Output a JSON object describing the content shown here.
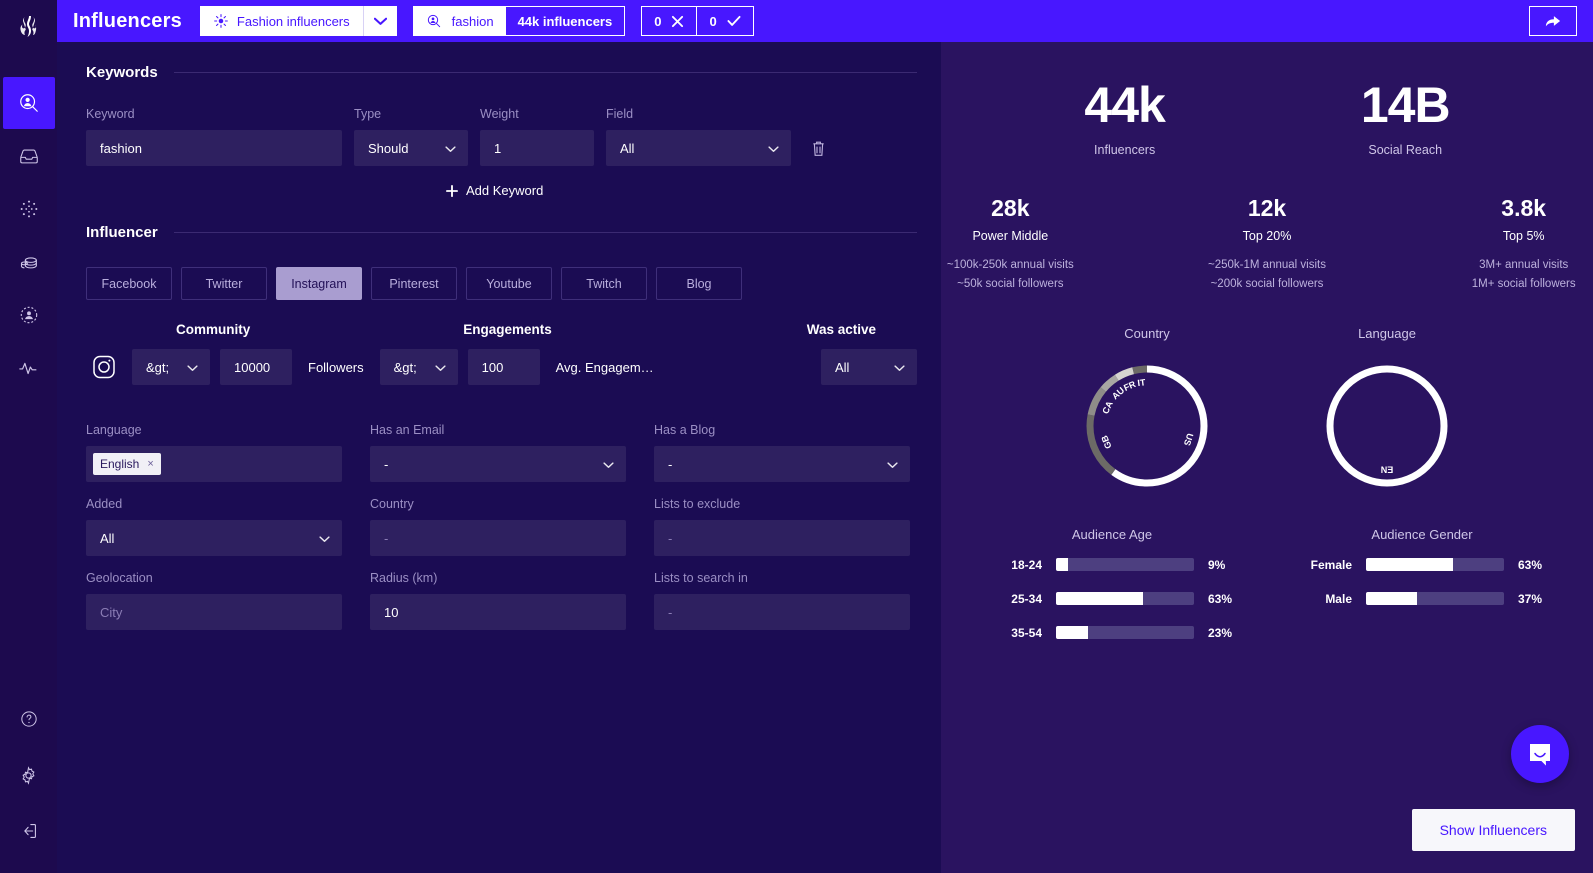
{
  "header": {
    "title": "Influencers",
    "segment_pill": {
      "label": "Fashion influencers",
      "icon": "target-icon"
    },
    "caret_icon": "chevron-down-icon",
    "search": {
      "icon": "person-search-icon",
      "value": "fashion",
      "count_label": "44k influencers"
    },
    "counters": [
      {
        "value": "0",
        "icon": "x-icon"
      },
      {
        "value": "0",
        "icon": "check-icon"
      }
    ],
    "share_icon": "share-arrow-icon"
  },
  "rail": {
    "logo": "flame-logo-icon",
    "items": [
      {
        "name": "search",
        "icon": "person-search-icon",
        "active": true
      },
      {
        "name": "inbox",
        "icon": "inbox-icon",
        "active": false
      },
      {
        "name": "network",
        "icon": "dot-network-icon",
        "active": false
      },
      {
        "name": "coins",
        "icon": "coins-stack-icon",
        "active": false
      },
      {
        "name": "audience",
        "icon": "people-circle-icon",
        "active": false
      },
      {
        "name": "activity",
        "icon": "pulse-icon",
        "active": false
      }
    ],
    "bottom_items": [
      {
        "name": "help",
        "icon": "question-circle-icon"
      },
      {
        "name": "settings",
        "icon": "gear-icon"
      },
      {
        "name": "logout",
        "icon": "logout-icon"
      }
    ]
  },
  "keywords": {
    "section_title": "Keywords",
    "col_keyword": "Keyword",
    "col_type": "Type",
    "col_weight": "Weight",
    "col_field": "Field",
    "row": {
      "keyword": "fashion",
      "type": "Should",
      "weight": "1",
      "field": "All"
    },
    "delete_icon": "trash-icon",
    "add_label": "Add Keyword",
    "add_icon": "plus-icon"
  },
  "influencer": {
    "section_title": "Influencer",
    "networks": [
      {
        "label": "Facebook",
        "active": false
      },
      {
        "label": "Twitter",
        "active": false
      },
      {
        "label": "Instagram",
        "active": true
      },
      {
        "label": "Pinterest",
        "active": false
      },
      {
        "label": "Youtube",
        "active": false
      },
      {
        "label": "Twitch",
        "active": false
      },
      {
        "label": "Blog",
        "active": false
      }
    ],
    "group_community": "Community",
    "group_engagements": "Engagements",
    "group_active": "Was active",
    "network_icon": "instagram-icon",
    "community_operator": "&gt;",
    "community_value": "10000",
    "community_unit": "Followers",
    "engagement_operator": "&gt;",
    "engagement_value": "100",
    "engagement_unit": "Avg. Engagem…",
    "active_value": "All",
    "fields": [
      {
        "label": "Language",
        "kind": "tag",
        "tag": "English",
        "tag_remove": "×"
      },
      {
        "label": "Has an Email",
        "kind": "select",
        "value": "-"
      },
      {
        "label": "Has a Blog",
        "kind": "select",
        "value": "-"
      },
      {
        "label": "Added",
        "kind": "select",
        "value": "All"
      },
      {
        "label": "Country",
        "kind": "input",
        "value": "-"
      },
      {
        "label": "Lists to exclude",
        "kind": "input",
        "value": "-"
      },
      {
        "label": "Geolocation",
        "kind": "input",
        "value": "City",
        "placeholder": true
      },
      {
        "label": "Radius (km)",
        "kind": "input",
        "value": "10"
      },
      {
        "label": "Lists to search in",
        "kind": "input",
        "value": "-"
      }
    ]
  },
  "stats": {
    "headline": [
      {
        "value": "44k",
        "label": "Influencers"
      },
      {
        "value": "14B",
        "label": "Social Reach"
      }
    ],
    "tiers": [
      {
        "value": "28k",
        "label": "Power Middle",
        "line1": "~100k-250k annual visits",
        "line2": "~50k social followers"
      },
      {
        "value": "12k",
        "label": "Top 20%",
        "line1": "~250k-1M annual visits",
        "line2": "~200k social followers"
      },
      {
        "value": "3.8k",
        "label": "Top 5%",
        "line1": "3M+ annual visits",
        "line2": "1M+ social followers"
      }
    ],
    "show_influencers": "Show Influencers",
    "chat_icon": "chat-bubble-icon"
  },
  "chart_data": [
    {
      "type": "pie",
      "title": "Country",
      "categories": [
        "US",
        "GB",
        "CA",
        "AU",
        "FR",
        "IT"
      ],
      "values": [
        60,
        18,
        8,
        5,
        5,
        4
      ],
      "colors": [
        "#ffffff",
        "#6c6a66",
        "#8f8d89",
        "#a9a7a3",
        "#d6d4d0",
        "#6c6a66"
      ],
      "legend": "inline-labels",
      "donut": true
    },
    {
      "type": "pie",
      "title": "Language",
      "categories": [
        "EN"
      ],
      "values": [
        100
      ],
      "colors": [
        "#ffffff"
      ],
      "legend": "inline-labels",
      "donut": true
    },
    {
      "type": "bar",
      "title": "Audience Age",
      "orientation": "horizontal",
      "categories": [
        "18-24",
        "25-34",
        "35-54"
      ],
      "values": [
        9,
        63,
        23
      ],
      "value_labels": [
        "9%",
        "63%",
        "23%"
      ],
      "xlim": [
        0,
        100
      ],
      "ylabel": "",
      "xlabel": ""
    },
    {
      "type": "bar",
      "title": "Audience Gender",
      "orientation": "horizontal",
      "categories": [
        "Female",
        "Male"
      ],
      "values": [
        63,
        37
      ],
      "value_labels": [
        "63%",
        "37%"
      ],
      "xlim": [
        0,
        100
      ],
      "ylabel": "",
      "xlabel": ""
    }
  ],
  "colors": {
    "brand": "#4817ff",
    "left_panel": "#1b0c53",
    "right_panel": "#2a1360",
    "input": "#2e2060"
  }
}
